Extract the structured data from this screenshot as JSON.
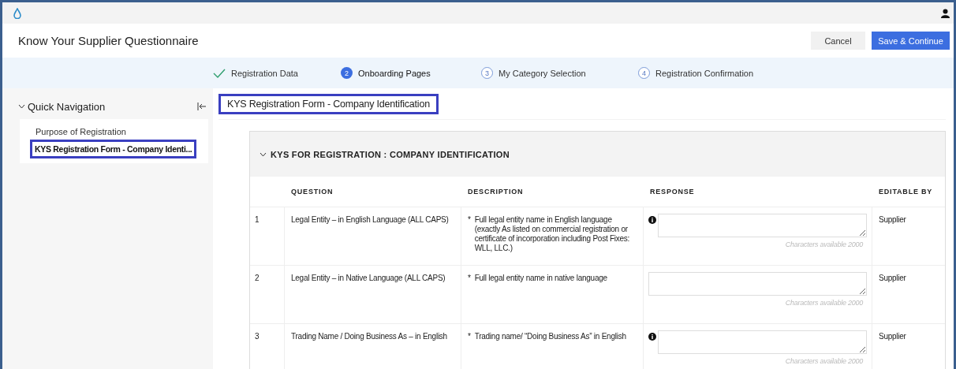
{
  "header": {
    "title": "Know Your Supplier Questionnaire",
    "buttons": [
      {
        "label": "Cancel",
        "kind": "secondary"
      },
      {
        "label": "Save & Continue",
        "kind": "primary"
      }
    ]
  },
  "steps": [
    {
      "label": "Registration Data",
      "completed": true,
      "selected": false
    },
    {
      "label": "Onboarding Pages",
      "completed": false,
      "selected": true,
      "number": "2"
    },
    {
      "label": "My Category Selection",
      "completed": false,
      "selected": false,
      "number": "3"
    },
    {
      "label": "Registration Confirmation",
      "completed": false,
      "selected": false,
      "number": "4"
    }
  ],
  "quick_navigation": {
    "title": "Quick Navigation",
    "expanded": true,
    "items": [
      {
        "label": "Purpose of Registration",
        "selected": false
      },
      {
        "label": "KYS Registration Form - Company Identi...",
        "selected": true
      }
    ]
  },
  "page_heading": "KYS Registration Form - Company Identification",
  "section": {
    "title": "KYS FOR REGISTRATION : COMPANY IDENTIFICATION",
    "expanded": true,
    "columns": [
      "QUESTION",
      "DESCRIPTION",
      "RESPONSE",
      "EDITABLE BY"
    ],
    "rows": [
      {
        "number": "1",
        "question": "Legal Entity – in English Language (ALL CAPS)",
        "marker": "*",
        "description": "Full legal entity name in English language (exactly As listed on commercial registration or certificate of incorporation including Post Fixes: WLL, LLC.)",
        "info": true,
        "counter": "Characters available 2000",
        "editable_by": "Supplier"
      },
      {
        "number": "2",
        "question": "Legal Entity – in Native Language (ALL CAPS)",
        "marker": "*",
        "description": "Full legal entity name in native language",
        "info": false,
        "counter": "Characters available 2000",
        "editable_by": "Supplier"
      },
      {
        "number": "3",
        "question": "Trading Name / Doing Business As – in English",
        "marker": "*",
        "description": "Trading name/ “Doing Business As” in English",
        "info": true,
        "counter": "Characters available 2000",
        "editable_by": "Supplier"
      }
    ]
  }
}
